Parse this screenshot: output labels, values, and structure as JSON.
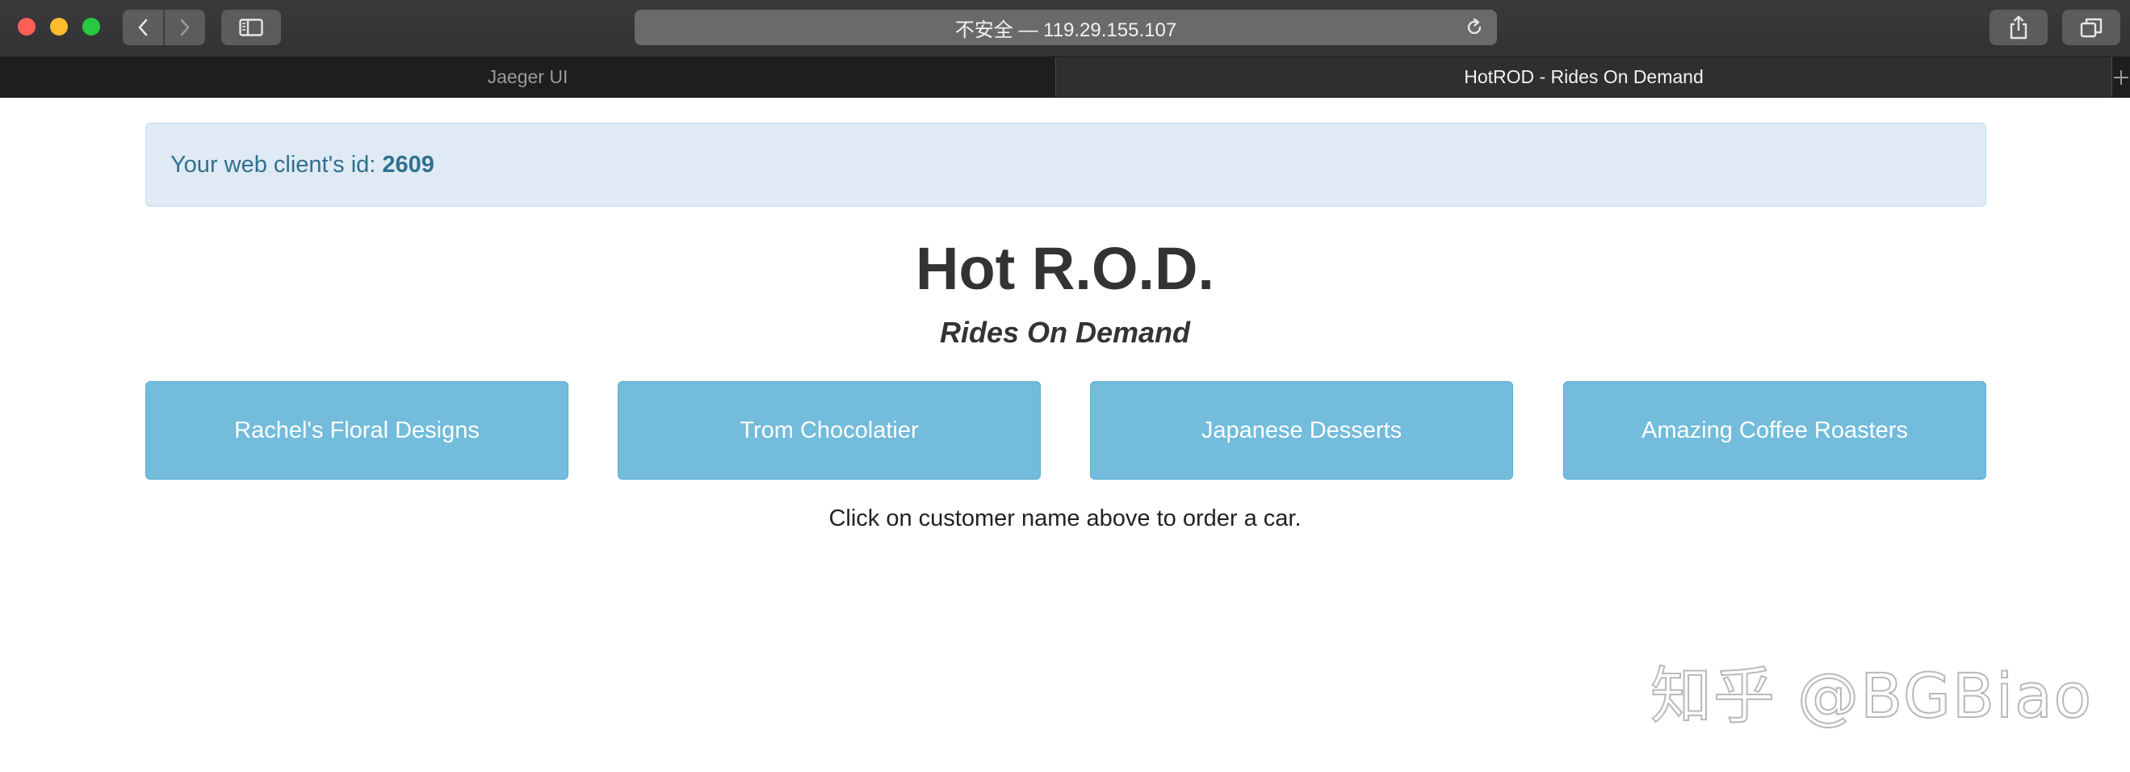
{
  "browser": {
    "address": "不安全 — 119.29.155.107",
    "tabs": [
      {
        "label": "Jaeger UI",
        "active": false
      },
      {
        "label": "HotROD - Rides On Demand",
        "active": true
      }
    ]
  },
  "alert": {
    "prefix": "Your web client's id:",
    "client_id": "2609"
  },
  "page": {
    "title": "Hot R.O.D.",
    "subtitle": "Rides On Demand",
    "hint": "Click on customer name above to order a car."
  },
  "customers": [
    {
      "label": "Rachel's Floral Designs"
    },
    {
      "label": "Trom Chocolatier"
    },
    {
      "label": "Japanese Desserts"
    },
    {
      "label": "Amazing Coffee Roasters"
    }
  ],
  "watermark": "知乎 @BGBiao",
  "colors": {
    "alert_bg": "#dfeaf4",
    "alert_text": "#31708f",
    "button_bg": "#73bcdb",
    "button_text": "#ffffff"
  }
}
